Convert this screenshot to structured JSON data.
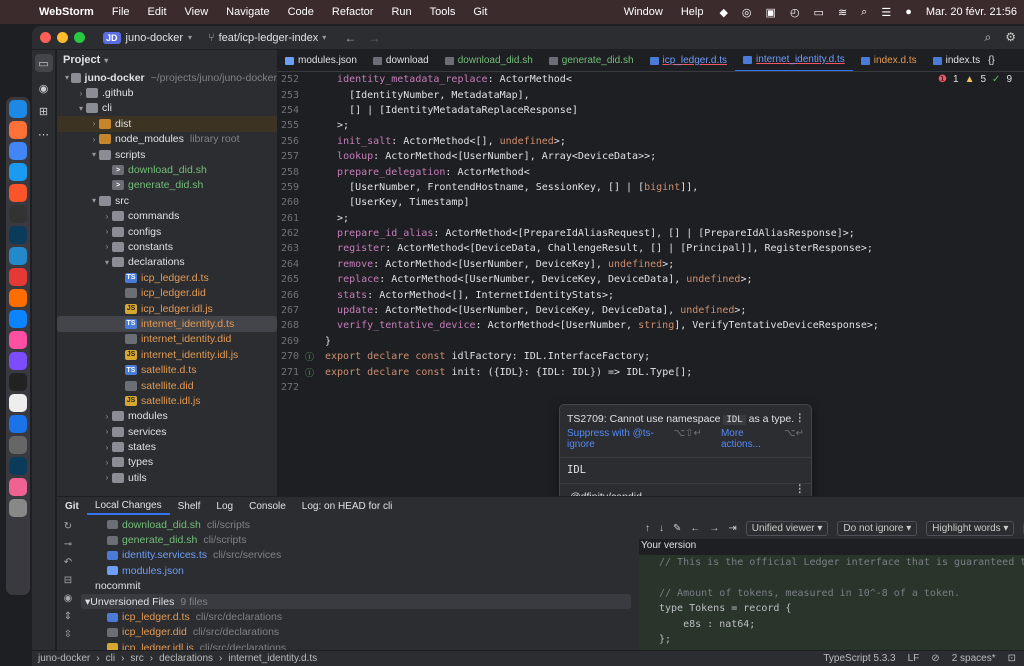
{
  "menubar": {
    "app": "WebStorm",
    "items": [
      "File",
      "Edit",
      "View",
      "Navigate",
      "Code",
      "Refactor",
      "Run",
      "Tools",
      "Git"
    ],
    "right_items": [
      "Window",
      "Help"
    ],
    "clock": "Mar. 20 févr.  21:56"
  },
  "dock": {
    "items": [
      "finder",
      "firefox",
      "chrome",
      "safari",
      "brave",
      "rr",
      "webstorm",
      "vscode",
      "app-red",
      "app-orange",
      "xcode",
      "app-rainbow",
      "app-purple",
      "terminal",
      "app-p",
      "onepassword",
      "settings",
      "webstorm2",
      "app-pink",
      "trash"
    ]
  },
  "titlebar": {
    "project_badge": "JD",
    "project": "juno-docker",
    "branch": "feat/icp-ledger-index"
  },
  "project_panel": {
    "title": "Project",
    "tree": [
      {
        "depth": 0,
        "label": "juno-docker",
        "sub": "~/projects/juno/juno-docker",
        "kind": "folder",
        "open": true,
        "bold": true
      },
      {
        "depth": 1,
        "label": ".github",
        "kind": "folder",
        "open": false
      },
      {
        "depth": 1,
        "label": "cli",
        "kind": "folder",
        "open": true
      },
      {
        "depth": 2,
        "label": "dist",
        "kind": "folder-excl",
        "open": false,
        "hl": true
      },
      {
        "depth": 2,
        "label": "node_modules",
        "sub": "library root",
        "kind": "folder-excl",
        "open": false
      },
      {
        "depth": 2,
        "label": "scripts",
        "kind": "folder",
        "open": true
      },
      {
        "depth": 3,
        "label": "download_did.sh",
        "kind": "sh",
        "color": "#73bd79"
      },
      {
        "depth": 3,
        "label": "generate_did.sh",
        "kind": "sh",
        "color": "#73bd79"
      },
      {
        "depth": 2,
        "label": "src",
        "kind": "folder",
        "open": true
      },
      {
        "depth": 3,
        "label": "commands",
        "kind": "folder",
        "open": false
      },
      {
        "depth": 3,
        "label": "configs",
        "kind": "folder",
        "open": false
      },
      {
        "depth": 3,
        "label": "constants",
        "kind": "folder",
        "open": false
      },
      {
        "depth": 3,
        "label": "declarations",
        "kind": "folder",
        "open": true
      },
      {
        "depth": 4,
        "label": "icp_ledger.d.ts",
        "kind": "ts",
        "color": "#e39a54"
      },
      {
        "depth": 4,
        "label": "icp_ledger.did",
        "kind": "did",
        "color": "#e39a54"
      },
      {
        "depth": 4,
        "label": "icp_ledger.idl.js",
        "kind": "js",
        "color": "#e39a54"
      },
      {
        "depth": 4,
        "label": "internet_identity.d.ts",
        "kind": "ts",
        "color": "#e39a54",
        "selected": true
      },
      {
        "depth": 4,
        "label": "internet_identity.did",
        "kind": "did",
        "color": "#e39a54"
      },
      {
        "depth": 4,
        "label": "internet_identity.idl.js",
        "kind": "js",
        "color": "#e39a54"
      },
      {
        "depth": 4,
        "label": "satellite.d.ts",
        "kind": "ts",
        "color": "#e39a54"
      },
      {
        "depth": 4,
        "label": "satellite.did",
        "kind": "did",
        "color": "#e39a54"
      },
      {
        "depth": 4,
        "label": "satellite.idl.js",
        "kind": "js",
        "color": "#e39a54"
      },
      {
        "depth": 3,
        "label": "modules",
        "kind": "folder",
        "open": false
      },
      {
        "depth": 3,
        "label": "services",
        "kind": "folder",
        "open": false
      },
      {
        "depth": 3,
        "label": "states",
        "kind": "folder",
        "open": false
      },
      {
        "depth": 3,
        "label": "types",
        "kind": "folder",
        "open": false
      },
      {
        "depth": 3,
        "label": "utils",
        "kind": "folder",
        "open": false
      }
    ]
  },
  "editor": {
    "tabs": [
      {
        "label": "modules.json",
        "icon": "json"
      },
      {
        "label": "download",
        "icon": "sh"
      },
      {
        "label": "download_did.sh",
        "icon": "sh",
        "green": true
      },
      {
        "label": "generate_did.sh",
        "icon": "sh",
        "green": true
      },
      {
        "label": "icp_ledger.d.ts",
        "icon": "ts",
        "err": true
      },
      {
        "label": "internet_identity.d.ts",
        "icon": "ts",
        "active": true,
        "err": true
      },
      {
        "label": "index.d.ts",
        "icon": "ts",
        "orange": true
      },
      {
        "label": "index.ts",
        "icon": "ts"
      }
    ],
    "inspections": {
      "errors": "1",
      "warnings": "5",
      "ok": "9"
    },
    "lines": [
      {
        "n": "252",
        "code": "  identity_metadata_replace: ActorMethod<"
      },
      {
        "n": "253",
        "code": "    [IdentityNumber, MetadataMap],"
      },
      {
        "n": "254",
        "code": "    [] | [IdentityMetadataReplaceResponse]"
      },
      {
        "n": "255",
        "code": "  >;"
      },
      {
        "n": "256",
        "code": "  init_salt: ActorMethod<[], undefined>;"
      },
      {
        "n": "257",
        "code": "  lookup: ActorMethod<[UserNumber], Array<DeviceData>>;"
      },
      {
        "n": "258",
        "code": "  prepare_delegation: ActorMethod<"
      },
      {
        "n": "259",
        "code": "    [UserNumber, FrontendHostname, SessionKey, [] | [bigint]],"
      },
      {
        "n": "260",
        "code": "    [UserKey, Timestamp]"
      },
      {
        "n": "261",
        "code": "  >;"
      },
      {
        "n": "262",
        "code": "  prepare_id_alias: ActorMethod<[PrepareIdAliasRequest], [] | [PrepareIdAliasResponse]>;"
      },
      {
        "n": "263",
        "code": "  register: ActorMethod<[DeviceData, ChallengeResult, [] | [Principal]], RegisterResponse>;"
      },
      {
        "n": "264",
        "code": "  remove: ActorMethod<[UserNumber, DeviceKey], undefined>;"
      },
      {
        "n": "265",
        "code": "  replace: ActorMethod<[UserNumber, DeviceKey, DeviceData], undefined>;"
      },
      {
        "n": "266",
        "code": "  stats: ActorMethod<[], InternetIdentityStats>;"
      },
      {
        "n": "267",
        "code": "  update: ActorMethod<[UserNumber, DeviceKey, DeviceData], undefined>;"
      },
      {
        "n": "268",
        "code": "  verify_tentative_device: ActorMethod<[UserNumber, string], VerifyTentativeDeviceResponse>;"
      },
      {
        "n": "269",
        "code": "}"
      },
      {
        "n": "270",
        "code": "export declare const idlFactory: IDL.InterfaceFactory;",
        "gutter": "ⓘ"
      },
      {
        "n": "271",
        "code": "export declare const init: ({IDL}: {IDL: IDL}) => IDL.Type[];",
        "gutter": "ⓘ"
      },
      {
        "n": "272",
        "code": ""
      }
    ]
  },
  "popup": {
    "message_pre": "TS2709: Cannot use namespace ",
    "message_code": "IDL",
    "message_post": " as a type.",
    "suppress": "Suppress with @ts-ignore",
    "suppress_keys": "⌥⇧↵",
    "more": "More actions...",
    "more_keys": "⌥↵",
    "symbol": "IDL",
    "module": "@dfinity/candid"
  },
  "bottom": {
    "tabs": [
      "Git",
      "Local Changes",
      "Shelf",
      "Log",
      "Console",
      "Log: on HEAD for cli"
    ],
    "changes": [
      {
        "label": "download_did.sh",
        "sub": "cli/scripts",
        "color": "#73bd79",
        "kind": "sh",
        "indent": 1
      },
      {
        "label": "generate_did.sh",
        "sub": "cli/scripts",
        "color": "#73bd79",
        "kind": "sh",
        "indent": 1
      },
      {
        "label": "identity.services.ts",
        "sub": "cli/src/services",
        "color": "#6f9ef8",
        "kind": "ts",
        "indent": 1
      },
      {
        "label": "modules.json",
        "sub": "",
        "color": "#6f9ef8",
        "kind": "json",
        "indent": 1
      },
      {
        "label": "nocommit",
        "sub": "",
        "color": "#dfe1e5",
        "kind": "none",
        "indent": 0
      },
      {
        "label": "Unversioned Files",
        "sub": "9 files",
        "color": "#dfe1e5",
        "kind": "group",
        "indent": 0
      },
      {
        "label": "icp_ledger.d.ts",
        "sub": "cli/src/declarations",
        "color": "#e39a54",
        "kind": "ts",
        "indent": 1
      },
      {
        "label": "icp_ledger.did",
        "sub": "cli/src/declarations",
        "color": "#e39a54",
        "kind": "did",
        "indent": 1
      },
      {
        "label": "icp_ledger.idl.js",
        "sub": "cli/src/declarations",
        "color": "#e39a54",
        "kind": "js",
        "indent": 1
      }
    ],
    "diff_toolbar": {
      "viewer": "Unified viewer",
      "ignore": "Do not ignore",
      "highlight": "Highlight words"
    },
    "your_version": "Your version",
    "diff_lines": [
      "// This is the official Ledger interface that is guaranteed to be backwa",
      "",
      "// Amount of tokens, measured in 10^-8 of a token.",
      "type Tokens = record {",
      "    e8s : nat64;",
      "};"
    ]
  },
  "statusbar": {
    "crumbs": [
      "juno-docker",
      "cli",
      "src",
      "declarations",
      "internet_identity.d.ts"
    ],
    "ts": "TypeScript 5.3.3",
    "lf": "LF",
    "indent": "2 spaces*"
  }
}
